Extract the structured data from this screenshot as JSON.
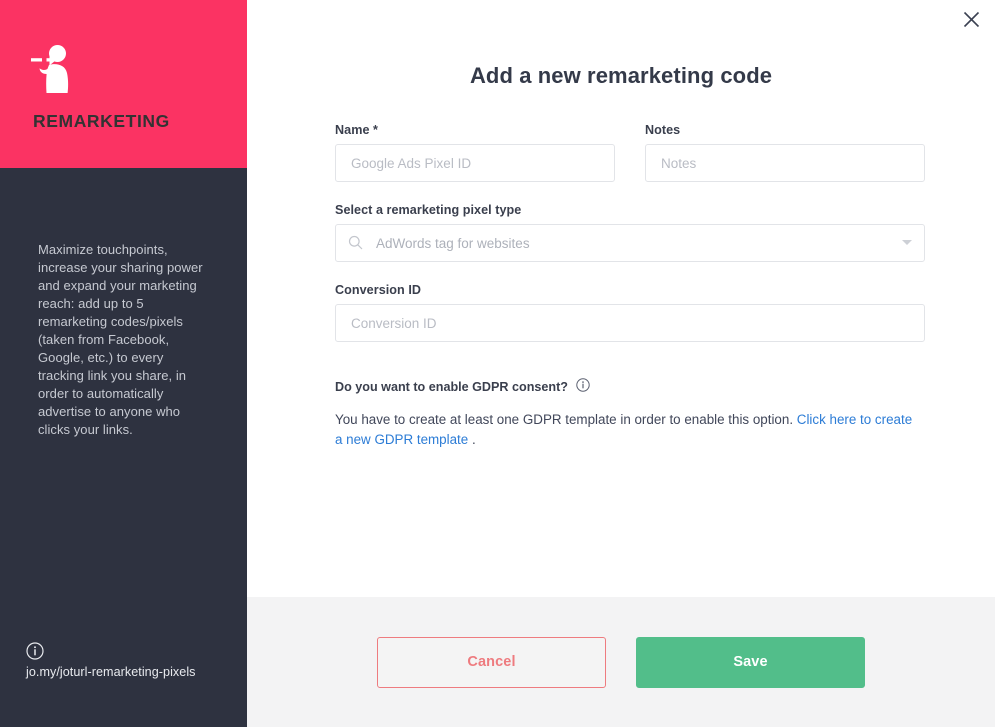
{
  "sidebar": {
    "brand_icon": "person-target-icon",
    "brand_title": "REMARKETING",
    "description": "Maximize touchpoints, increase your sharing power and expand your marketing reach: add up to 5 remarketing codes/pixels (taken from Facebook, Google, etc.) to every tracking link you share, in order to automatically advertise to anyone who clicks your links.",
    "info_icon": "info-circle-icon",
    "help_link": "jo.my/joturl-remarketing-pixels",
    "header_color": "#fb3363",
    "body_color": "#2e3240"
  },
  "main": {
    "close_icon": "close-icon",
    "title": "Add a new remarketing code",
    "fields": {
      "name": {
        "label": "Name *",
        "placeholder": "Google Ads Pixel ID",
        "value": ""
      },
      "notes": {
        "label": "Notes",
        "placeholder": "Notes",
        "value": ""
      },
      "pixel_type": {
        "label": "Select a remarketing pixel type",
        "search_icon": "search-icon",
        "selected": "AdWords tag for websites",
        "caret_icon": "chevron-down-icon"
      },
      "conversion_id": {
        "label": "Conversion ID",
        "placeholder": "Conversion ID",
        "value": ""
      }
    },
    "gdpr": {
      "question": "Do you want to enable GDPR consent?",
      "info_icon": "info-circle-icon",
      "notice_prefix": "You have to create at least one GDPR template in order to enable this option. ",
      "link_text": "Click here to create a new GDPR template",
      "notice_suffix": " .",
      "link_color": "#2c7cd6"
    }
  },
  "footer": {
    "cancel_label": "Cancel",
    "save_label": "Save",
    "cancel_color": "#ee7b7f",
    "save_color": "#52be8a"
  }
}
